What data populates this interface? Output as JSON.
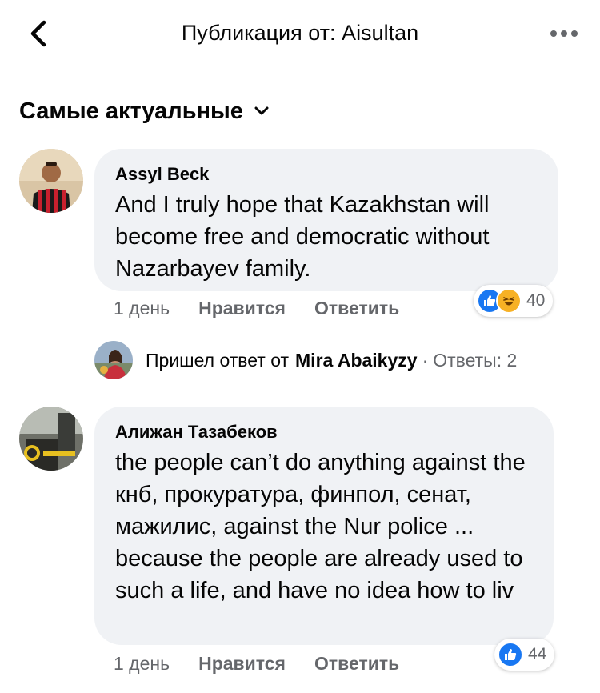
{
  "header": {
    "title": "Публикация от: Aisultan"
  },
  "sort": {
    "label": "Самые актуальные"
  },
  "comments": [
    {
      "author": "Assyl Beck",
      "text": "And I truly hope that Kazakhstan will become free and democratic without Nazarbayev family.",
      "time": "1 день",
      "like_label": "Нравится",
      "reply_label": "Ответить",
      "reaction_count": "40",
      "reactions": [
        "like-icon",
        "haha-icon"
      ]
    },
    {
      "author": "Алижан Тазабеков",
      "text": "the people can’t do anything against the кнб, прокуратура, финпол, сенат, мажилис, against the Nur police ... because the people are already used to such a life, and have no idea how to liv",
      "time": "1 день",
      "like_label": "Нравится",
      "reply_label": "Ответить",
      "reaction_count": "44",
      "reactions": [
        "like-icon"
      ]
    }
  ],
  "reply_preview": {
    "prefix": "Пришел ответ от",
    "name": "Mira Abaikyzy",
    "separator": "·",
    "count_label": "Ответы: 2"
  },
  "colors": {
    "bubble_bg": "#f0f2f5",
    "meta_text": "#65676b",
    "like_blue": "#1877f2",
    "haha_yellow": "#f7b125"
  }
}
